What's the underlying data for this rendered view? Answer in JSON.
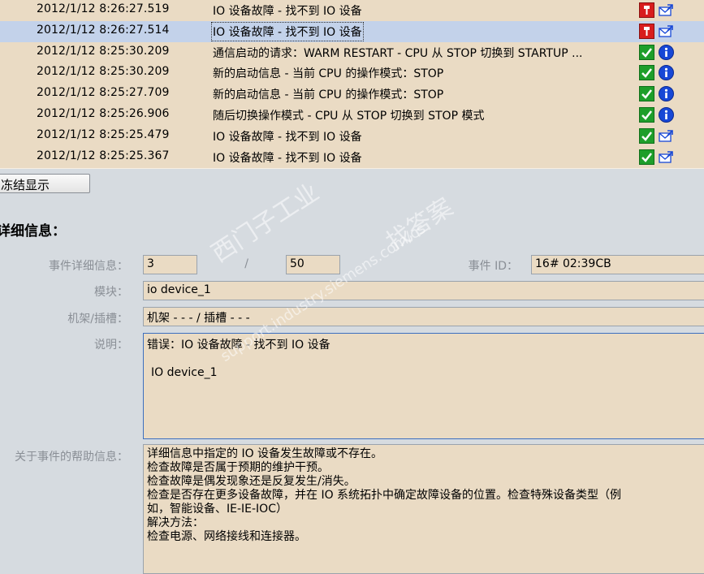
{
  "events": [
    {
      "timestamp": "2012/1/12 8:26:27.519",
      "message": "IO 设备故障 - 找不到 IO 设备",
      "status_icon": "wrench-icon",
      "info_icon": "mail-icon",
      "selected": false
    },
    {
      "timestamp": "2012/1/12 8:26:27.514",
      "message": "IO 设备故障 - 找不到 IO 设备",
      "status_icon": "wrench-icon",
      "info_icon": "mail-icon",
      "selected": true
    },
    {
      "timestamp": "2012/1/12 8:25:30.209",
      "message": "通信启动的请求：WARM RESTART - CPU 从 STOP 切换到 STARTUP ...",
      "status_icon": "check-icon",
      "info_icon": "info-icon",
      "selected": false
    },
    {
      "timestamp": "2012/1/12 8:25:30.209",
      "message": "新的启动信息 - 当前 CPU 的操作模式：STOP",
      "status_icon": "check-icon",
      "info_icon": "info-icon",
      "selected": false
    },
    {
      "timestamp": "2012/1/12 8:25:27.709",
      "message": "新的启动信息 - 当前 CPU 的操作模式：STOP",
      "status_icon": "check-icon",
      "info_icon": "info-icon",
      "selected": false
    },
    {
      "timestamp": "2012/1/12 8:25:26.906",
      "message": "随后切换操作模式 - CPU 从 STOP 切换到 STOP 模式",
      "status_icon": "check-icon",
      "info_icon": "info-icon",
      "selected": false
    },
    {
      "timestamp": "2012/1/12 8:25:25.479",
      "message": "IO 设备故障 - 找不到 IO 设备",
      "status_icon": "check-icon",
      "info_icon": "mail-icon",
      "selected": false
    },
    {
      "timestamp": "2012/1/12 8:25:25.367",
      "message": "IO 设备故障 - 找不到 IO 设备",
      "status_icon": "check-icon",
      "info_icon": "mail-icon",
      "selected": false
    }
  ],
  "freeze_button": {
    "label": "冻结显示"
  },
  "details": {
    "title": "详细信息：",
    "event_detail_label": "事件详细信息：",
    "event_detail_value": "3",
    "separator": "/",
    "event_total_value": "50",
    "event_id_label": "事件 ID：",
    "event_id_value": "16# 02:39CB",
    "module_label": "模块：",
    "module_value": "io device_1",
    "rack_label": "机架/插槽：",
    "rack_value": "机架 - - - / 插槽 - - -",
    "desc_label": "说明：",
    "desc_line1": "错误：IO 设备故障 - 找不到 IO 设备",
    "desc_line2": "IO device_1",
    "help_label": "关于事件的帮助信息：",
    "help_lines": [
      "详细信息中指定的 IO 设备发生故障或不存在。",
      "检查故障是否属于预期的维护干预。",
      "检查故障是偶发现象还是反复发生/消失。",
      "检查是否存在更多设备故障，并在 IO 系统拓扑中确定故障设备的位置。检查特殊设备类型（例",
      "如，智能设备、IE-IE-IOC）",
      "解决方法：",
      "检查电源、网络接线和连接器。"
    ]
  },
  "watermark": {
    "line1": "西门子工业",
    "line2": "support.industry.siemens.com/cs",
    "line3": "找答案"
  }
}
